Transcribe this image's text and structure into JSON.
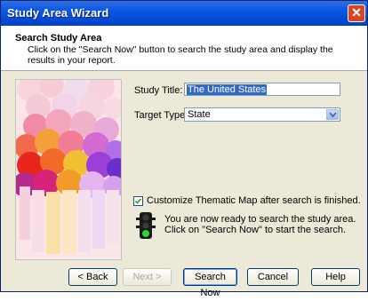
{
  "window": {
    "title": "Study Area Wizard",
    "close_glyph": "✕"
  },
  "header": {
    "title": "Search Study Area",
    "description": "Click on the \"Search Now\" button to search the study area and display the results in your report."
  },
  "form": {
    "study_title_label": "Study Title:",
    "study_title_value": "The United States",
    "target_type_label": "Target Type:",
    "target_type_value": "State",
    "customize_label": "Customize Thematic Map after search is finished.",
    "customize_checked": true
  },
  "info": {
    "message": "You are now ready to search the study area. Click on \"Search Now\" to start the search."
  },
  "buttons": {
    "back": "< Back",
    "next": "Next >",
    "search_now": "Search Now",
    "cancel": "Cancel",
    "help": "Help"
  },
  "icons": {
    "close": "close-icon",
    "checkmark": "checkmark-icon",
    "traffic_light": "traffic-light-icon",
    "dropdown": "chevron-down-icon"
  }
}
